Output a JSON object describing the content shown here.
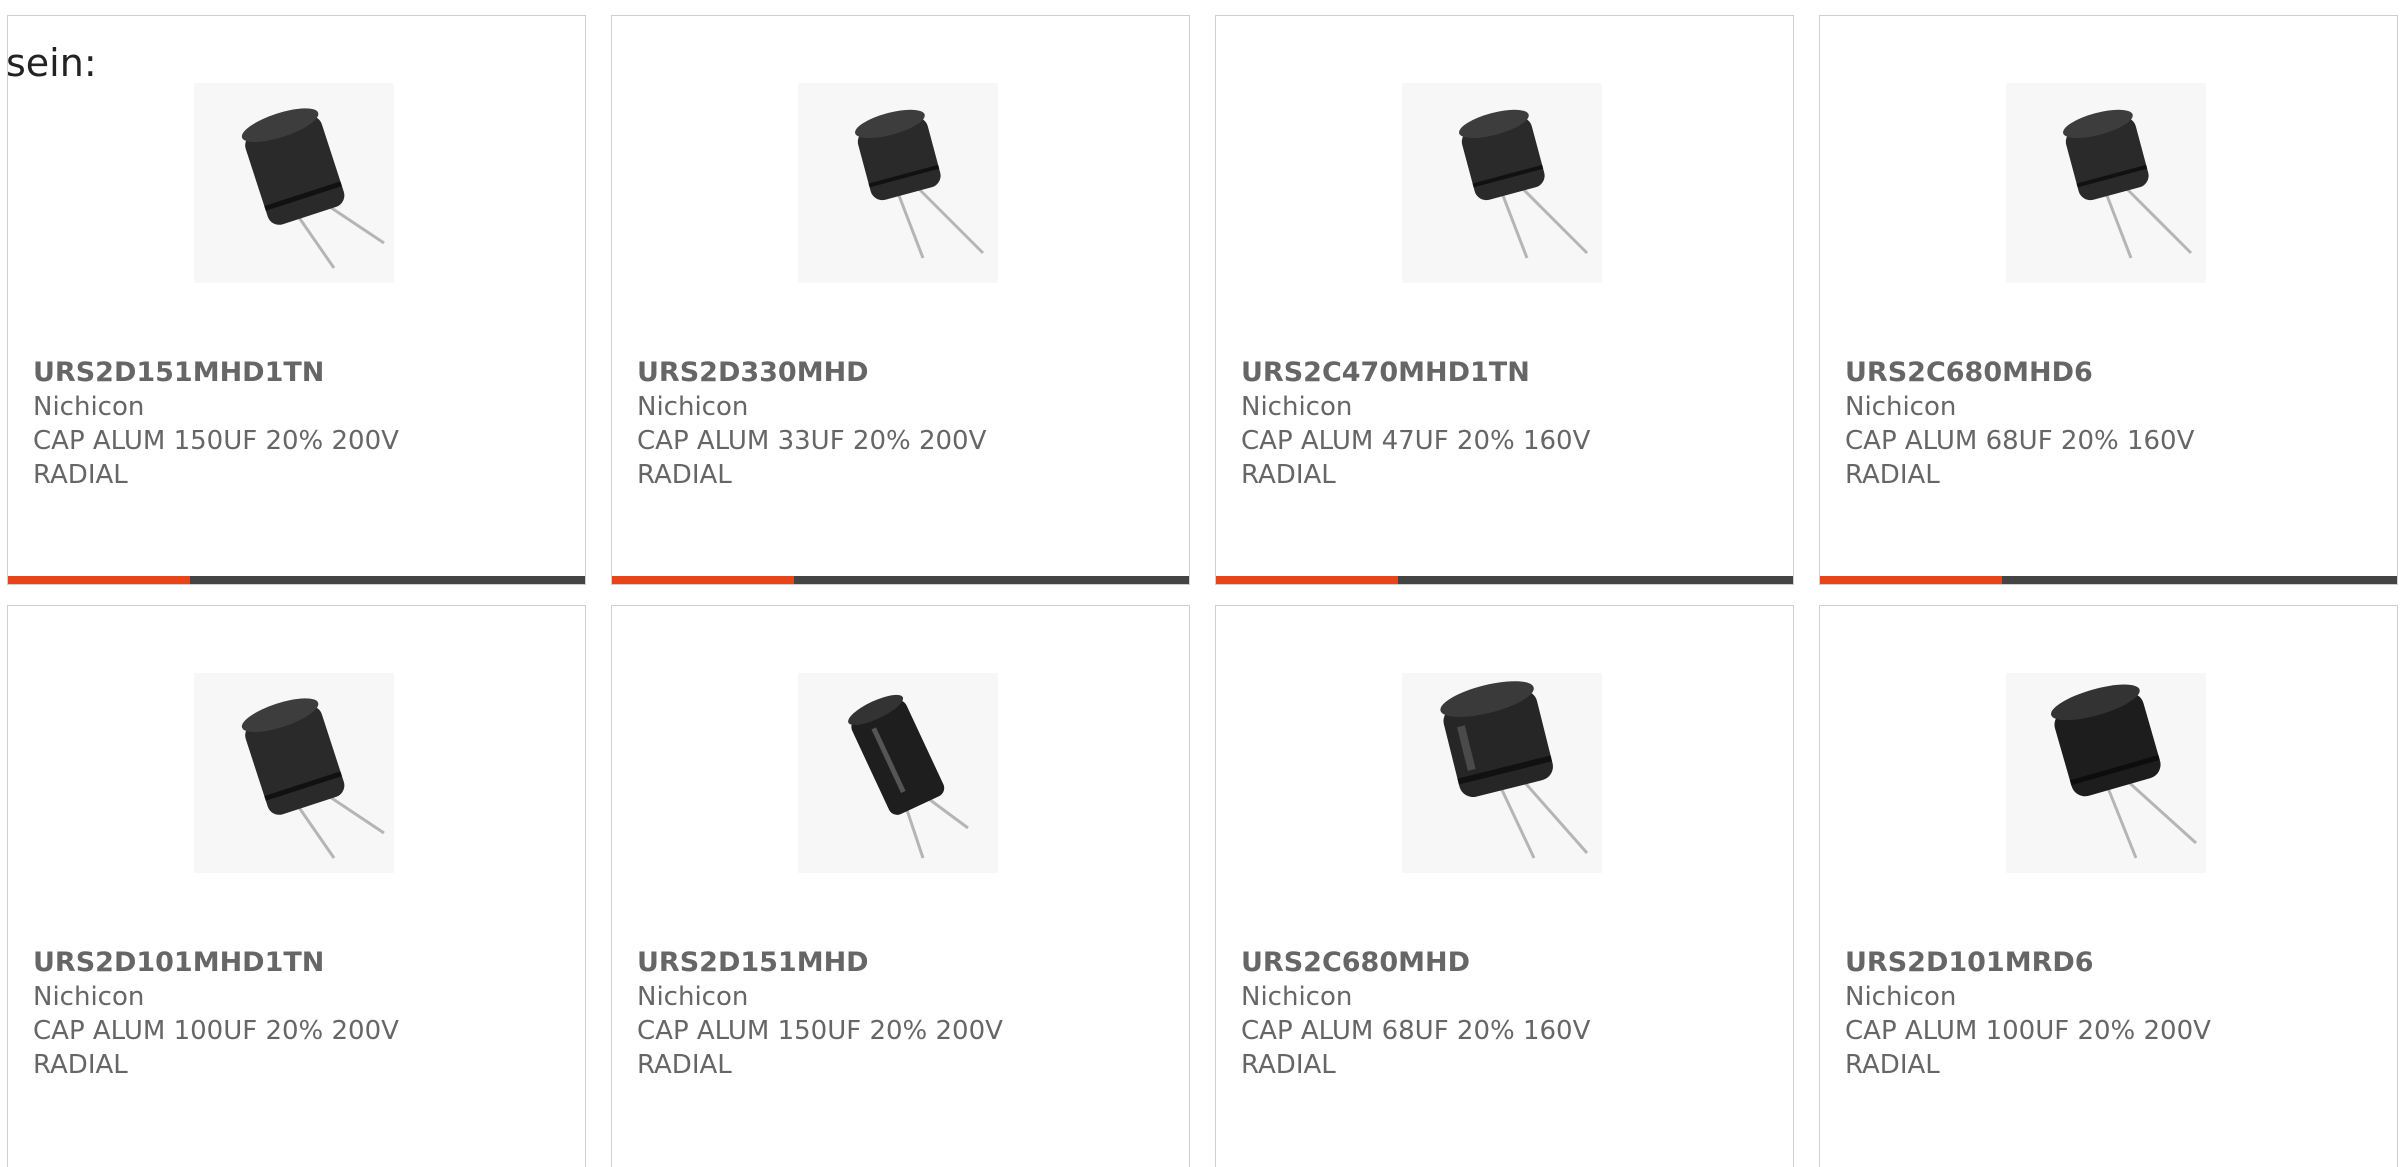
{
  "intro_text": "sein:",
  "colors": {
    "accent": "#e8441a",
    "bar_track": "#444444",
    "text": "#666666",
    "border": "#cfcfcf"
  },
  "products": [
    {
      "part": "URS2D151MHD1TN",
      "maker": "Nichicon",
      "desc1": "CAP ALUM 150UF 20% 200V",
      "desc2": "RADIAL",
      "image_icon": "capacitor-image"
    },
    {
      "part": "URS2D330MHD",
      "maker": "Nichicon",
      "desc1": "CAP ALUM 33UF 20% 200V",
      "desc2": "RADIAL",
      "image_icon": "capacitor-image"
    },
    {
      "part": "URS2C470MHD1TN",
      "maker": "Nichicon",
      "desc1": "CAP ALUM 47UF 20% 160V",
      "desc2": "RADIAL",
      "image_icon": "capacitor-image"
    },
    {
      "part": "URS2C680MHD6",
      "maker": "Nichicon",
      "desc1": "CAP ALUM 68UF 20% 160V",
      "desc2": "RADIAL",
      "image_icon": "capacitor-image"
    },
    {
      "part": "URS2D101MHD1TN",
      "maker": "Nichicon",
      "desc1": "CAP ALUM 100UF 20% 200V",
      "desc2": "RADIAL",
      "image_icon": "capacitor-image"
    },
    {
      "part": "URS2D151MHD",
      "maker": "Nichicon",
      "desc1": "CAP ALUM 150UF 20% 200V",
      "desc2": "RADIAL",
      "image_icon": "capacitor-image"
    },
    {
      "part": "URS2C680MHD",
      "maker": "Nichicon",
      "desc1": "CAP ALUM 68UF 20% 160V",
      "desc2": "RADIAL",
      "image_icon": "capacitor-image"
    },
    {
      "part": "URS2D101MRD6",
      "maker": "Nichicon",
      "desc1": "CAP ALUM 100UF 20% 200V",
      "desc2": "RADIAL",
      "image_icon": "capacitor-image"
    }
  ]
}
